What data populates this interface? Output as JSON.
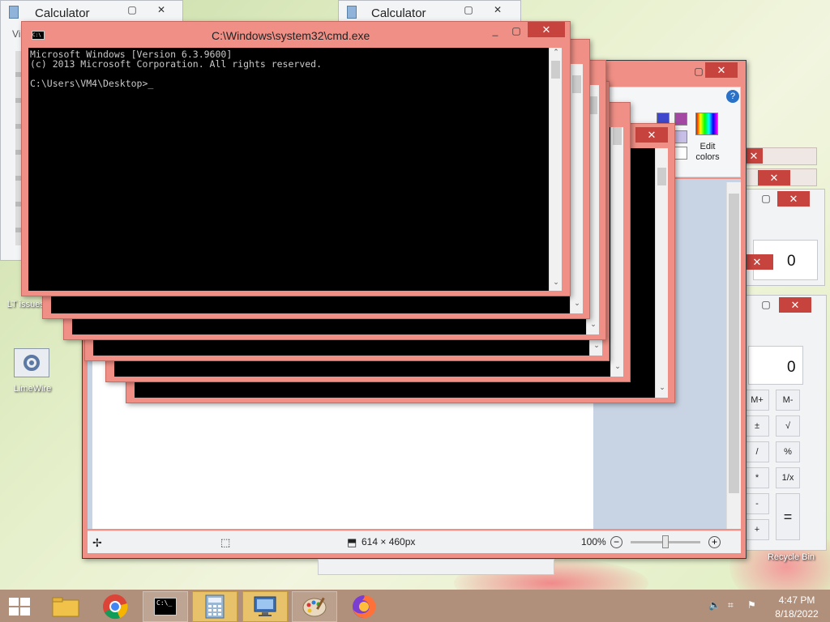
{
  "calculators": {
    "left_title": "Calculator",
    "right_title": "Calculator",
    "left_fragment": "Vi",
    "display_top": "0",
    "display_bottom": "0",
    "keys": {
      "mplus": "M+",
      "mminus": "M-",
      "plusminus": "±",
      "sqrt": "√",
      "divide": "/",
      "percent": "%",
      "multiply": "*",
      "reciprocal": "1/x",
      "minus": "-",
      "plus": "+",
      "equals": "="
    }
  },
  "cmd": {
    "title": "C:\\Windows\\system32\\cmd.exe",
    "line1": "Microsoft Windows [Version 6.3.9600]",
    "line2": "(c) 2013 Microsoft Corporation. All rights reserved.",
    "prompt": "C:\\Users\\VM4\\Desktop>"
  },
  "paint": {
    "edit_colors": "Edit colors",
    "status_size": "614 × 460px",
    "zoom_level": "100%",
    "zoom_percent": 100
  },
  "desktop": {
    "icon1_label": "LT issues!!!...",
    "icon2_label": "LimeWire",
    "icon3_label": "Recycle Bin"
  },
  "taskbar": {
    "time": "4:47 PM",
    "date": "8/18/2022"
  },
  "colors": {
    "cmd_frame": "#ef8f85",
    "close_red": "#c7443e",
    "taskbar": "#b0907a"
  }
}
